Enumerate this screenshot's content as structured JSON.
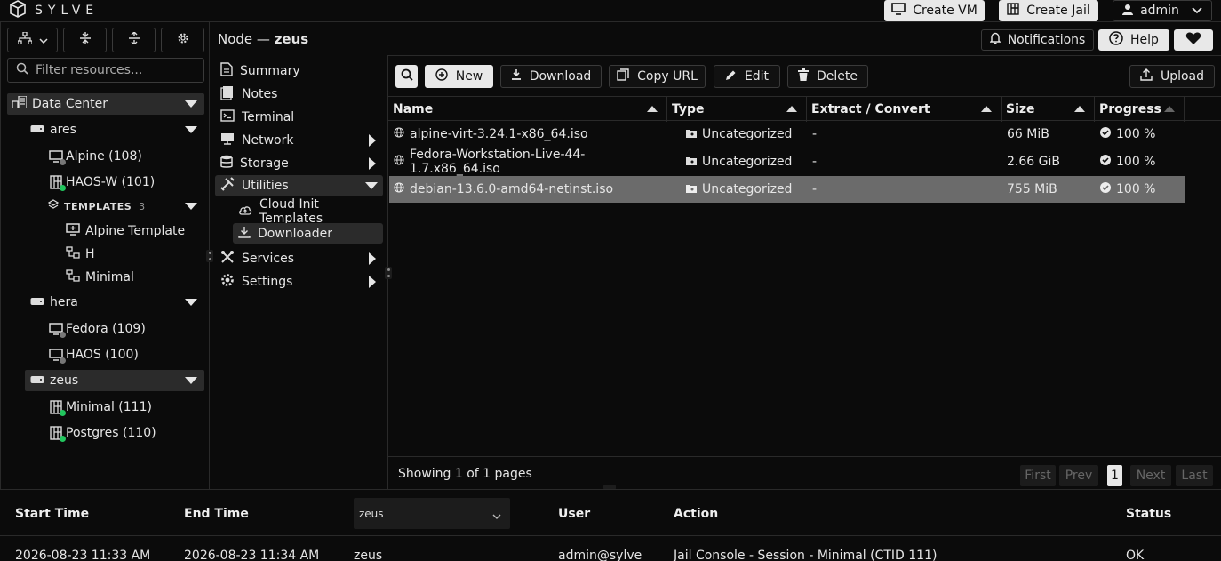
{
  "brand": {
    "name": "SYLVE"
  },
  "topbar": {
    "create_vm": "Create VM",
    "create_jail": "Create Jail",
    "user": "admin"
  },
  "header": {
    "node_prefix": "Node —",
    "node_name": "zeus",
    "notifications": "Notifications",
    "help": "Help"
  },
  "left": {
    "filter_placeholder": "Filter resources...",
    "tree": {
      "datacenter": "Data Center",
      "ares": "ares",
      "alpine": "Alpine (108)",
      "haos_w": "HAOS-W (101)",
      "templates_label": "TEMPLATES",
      "templates_count": "3",
      "alpine_template": "Alpine Template",
      "h": "H",
      "minimal_tpl": "Minimal",
      "hera": "hera",
      "fedora": "Fedora (109)",
      "haos": "HAOS (100)",
      "zeus": "zeus",
      "minimal": "Minimal (111)",
      "postgres": "Postgres (110)"
    }
  },
  "nav": {
    "summary": "Summary",
    "notes": "Notes",
    "terminal": "Terminal",
    "network": "Network",
    "storage": "Storage",
    "utilities": "Utilities",
    "cloud_init": "Cloud Init Templates",
    "downloader": "Downloader",
    "services": "Services",
    "settings": "Settings"
  },
  "toolbar": {
    "new": "New",
    "download": "Download",
    "copy_url": "Copy URL",
    "edit": "Edit",
    "delete": "Delete",
    "upload": "Upload"
  },
  "table": {
    "columns": [
      "Name",
      "Type",
      "Extract / Convert",
      "Size",
      "Progress"
    ],
    "rows": [
      {
        "name": "alpine-virt-3.24.1-x86_64.iso",
        "type": "Uncategorized",
        "extract": "-",
        "size": "66 MiB",
        "progress": "100 %"
      },
      {
        "name": "Fedora-Workstation-Live-44-1.7.x86_64.iso",
        "type": "Uncategorized",
        "extract": "-",
        "size": "2.66 GiB",
        "progress": "100 %"
      },
      {
        "name": "debian-13.6.0-amd64-netinst.iso",
        "type": "Uncategorized",
        "extract": "-",
        "size": "755 MiB",
        "progress": "100 %"
      }
    ]
  },
  "pagination": {
    "summary": "Showing 1 of 1 pages",
    "first": "First",
    "prev": "Prev",
    "page": "1",
    "next": "Next",
    "last": "Last"
  },
  "audit": {
    "columns": {
      "start": "Start Time",
      "end": "End Time",
      "node_filter": "zeus",
      "user": "User",
      "action": "Action",
      "status": "Status"
    },
    "row": {
      "start": "2026-08-23 11:33 AM",
      "end": "2026-08-23 11:34 AM",
      "node": "zeus",
      "user": "admin@sylve",
      "action": "Jail Console - Session - Minimal (CTID 111)",
      "status": "OK"
    }
  },
  "colors": {
    "accent_green": "#22c55e",
    "selected_row": "#6b6b6b",
    "panel_bg": "#0b0b0b"
  }
}
